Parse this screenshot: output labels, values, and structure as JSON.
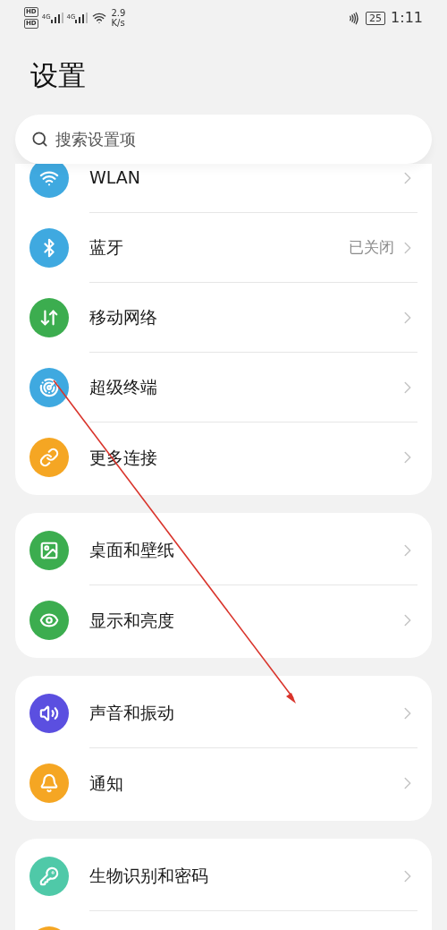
{
  "status_bar": {
    "sim_labels": [
      "HD",
      "HD"
    ],
    "network": [
      "4G",
      "4G"
    ],
    "speed": "2.9",
    "speed_unit": "K/s",
    "battery": "25",
    "time": "1:11"
  },
  "title": "设置",
  "search": {
    "placeholder": "搜索设置项"
  },
  "groups": [
    {
      "items": [
        {
          "kind": "wifi",
          "color": "#3fa9e0",
          "label": "WLAN"
        },
        {
          "kind": "bluetooth",
          "color": "#3fa9e0",
          "label": "蓝牙",
          "value": "已关闭"
        },
        {
          "kind": "mobile",
          "color": "#3cad4f",
          "label": "移动网络"
        },
        {
          "kind": "devices",
          "color": "#3fa9e0",
          "label": "超级终端"
        },
        {
          "kind": "link",
          "color": "#f5a623",
          "label": "更多连接"
        }
      ]
    },
    {
      "items": [
        {
          "kind": "wallpaper",
          "color": "#3cad4f",
          "label": "桌面和壁纸"
        },
        {
          "kind": "display",
          "color": "#3cad4f",
          "label": "显示和亮度"
        }
      ]
    },
    {
      "items": [
        {
          "kind": "sound",
          "color": "#5b4fe0",
          "label": "声音和振动"
        },
        {
          "kind": "bell",
          "color": "#f5a623",
          "label": "通知"
        }
      ]
    },
    {
      "items": [
        {
          "kind": "key",
          "color": "#4fc9a8",
          "label": "生物识别和密码"
        },
        {
          "kind": "blank",
          "color": "#f5a623"
        }
      ]
    }
  ],
  "annotation": {
    "kind": "arrow"
  }
}
